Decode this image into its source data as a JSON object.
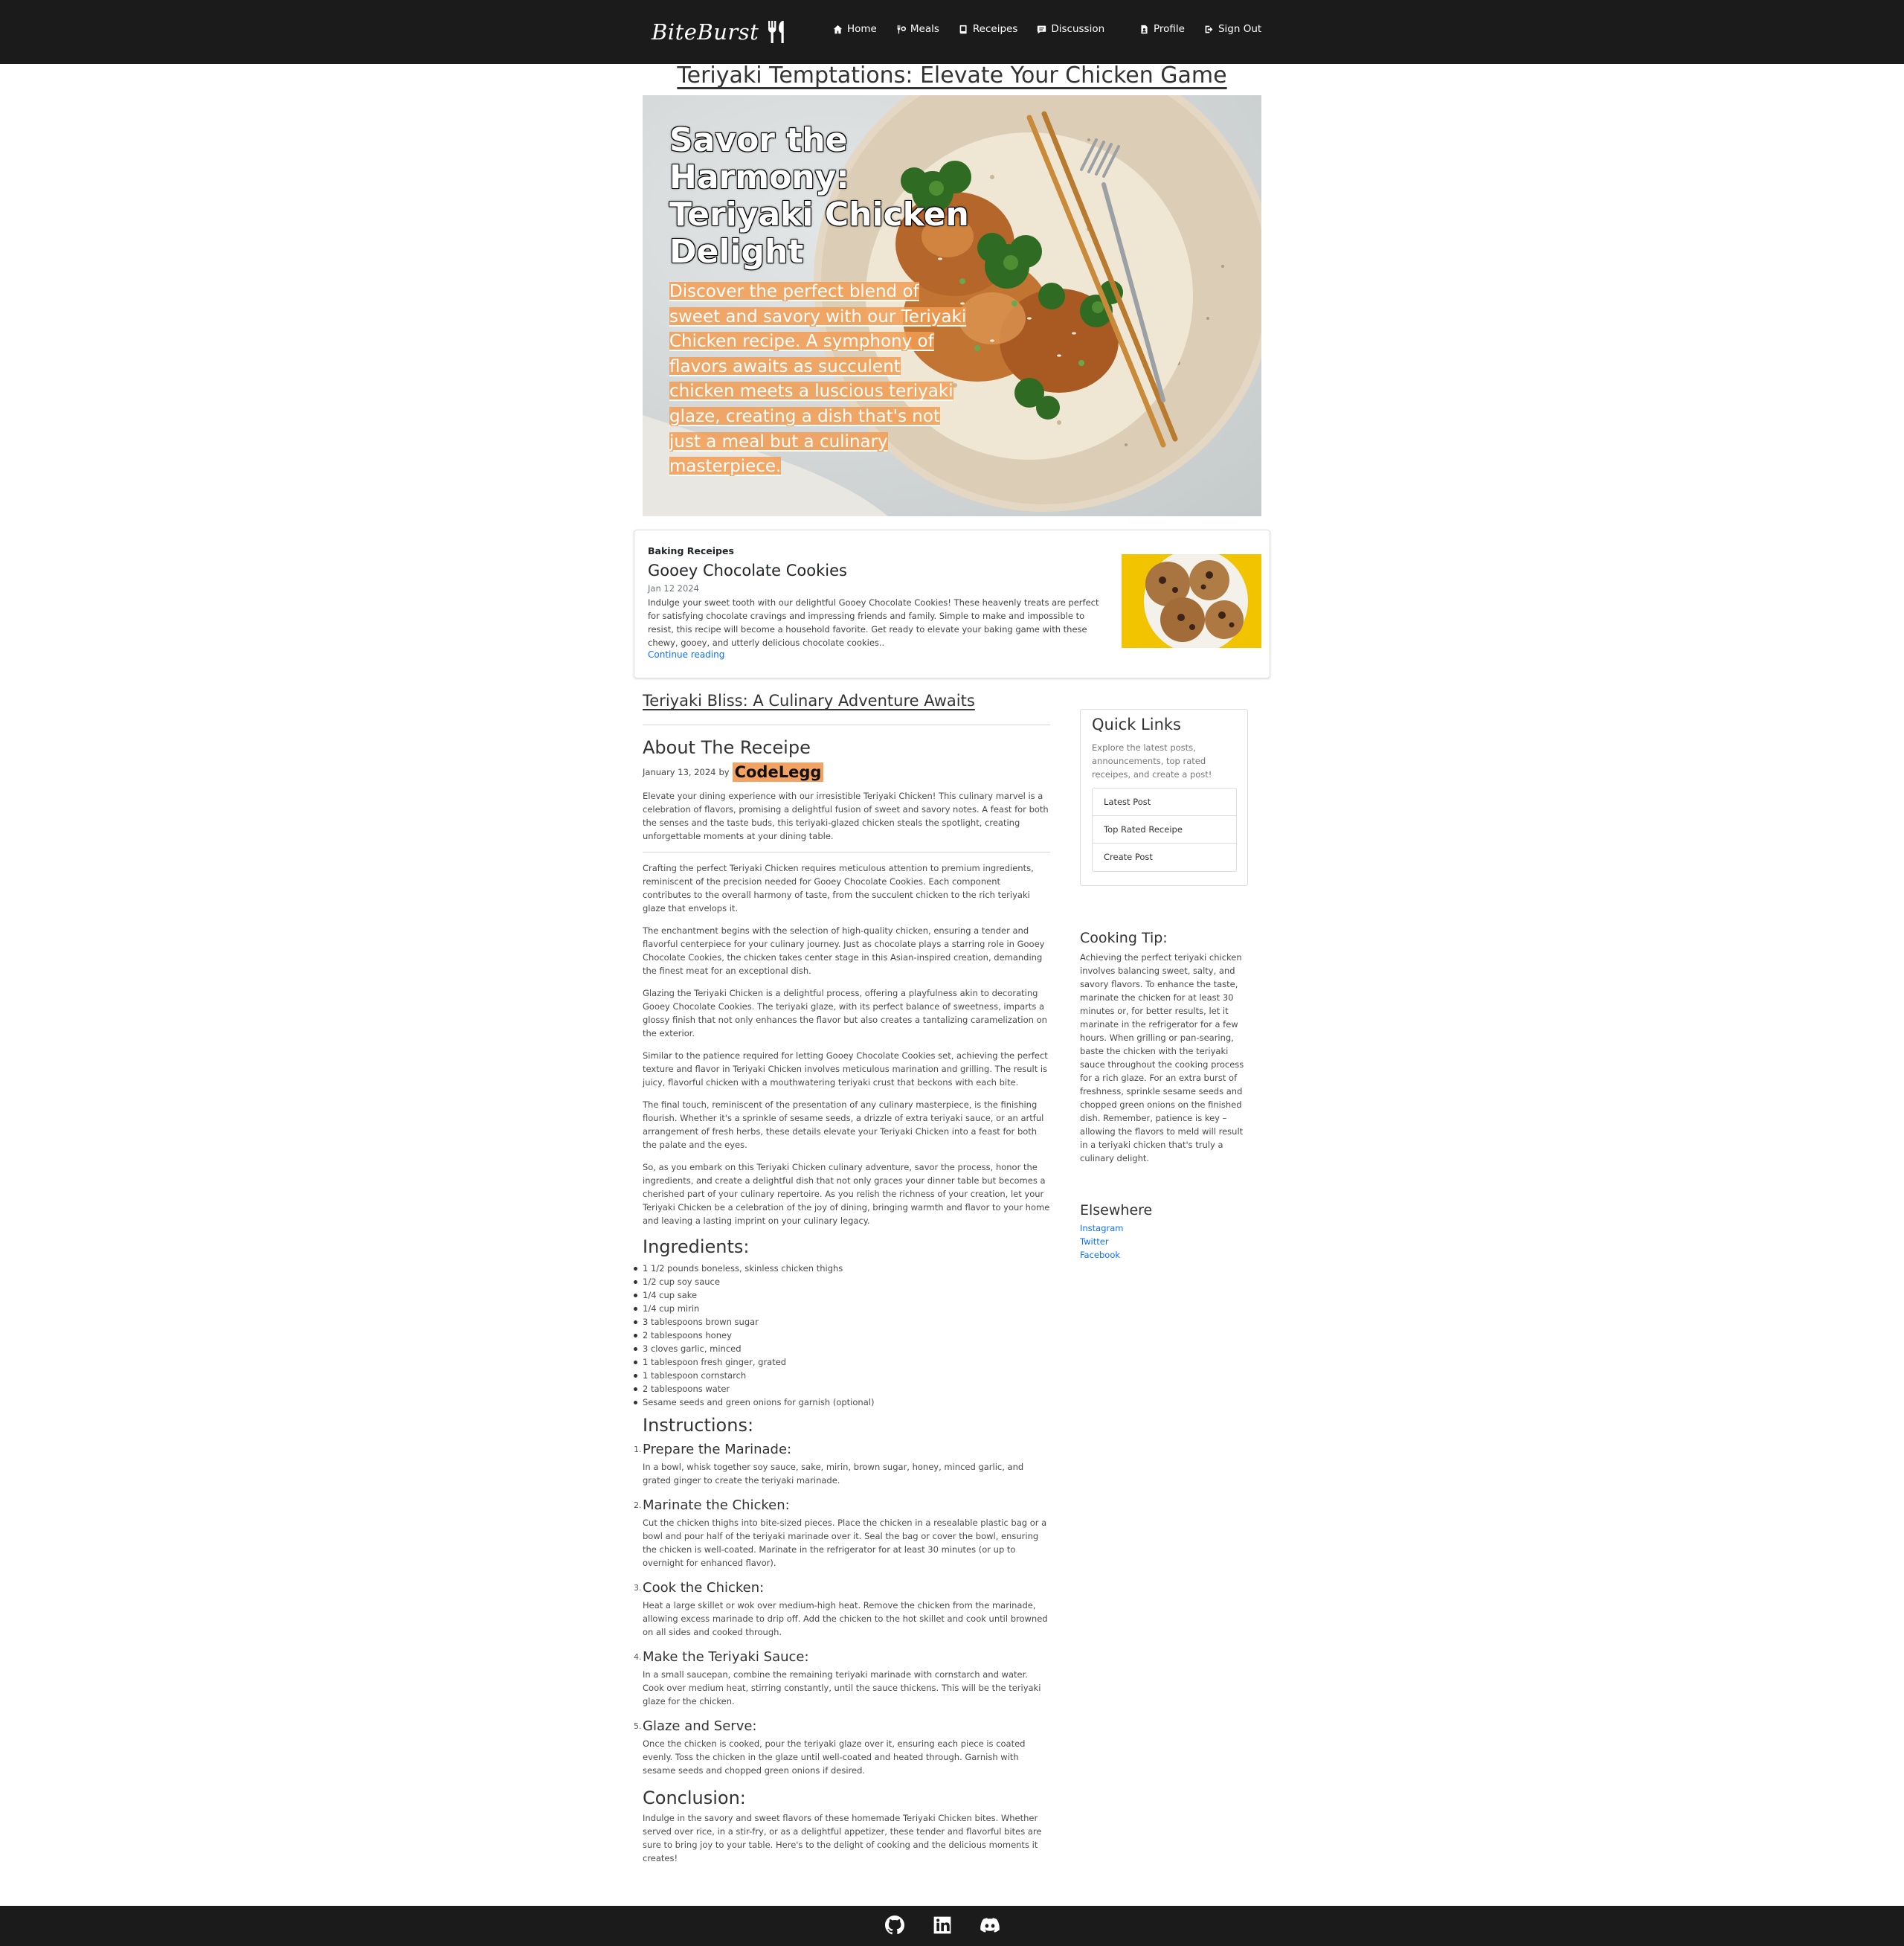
{
  "brand": {
    "name": "BiteBurst",
    "icon": "fork-knife-icon"
  },
  "nav": {
    "links": [
      {
        "label": "Home",
        "icon": "home-icon"
      },
      {
        "label": "Meals",
        "icon": "meals-icon"
      },
      {
        "label": "Receipes",
        "icon": "book-icon"
      },
      {
        "label": "Discussion",
        "icon": "chat-icon"
      }
    ],
    "right": [
      {
        "label": "Profile",
        "icon": "profile-icon"
      },
      {
        "label": "Sign Out",
        "icon": "sign-out-icon"
      }
    ]
  },
  "page_title": "Teriyaki Temptations: Elevate Your Chicken Game",
  "hero": {
    "heading": "Savor the Harmony: Teriyaki Chicken Delight",
    "description": "Discover the perfect blend of sweet and savory with our Teriyaki Chicken recipe. A symphony of flavors awaits as succulent chicken meets a luscious teriyaki glaze, creating a dish that's not just a meal but a culinary masterpiece."
  },
  "featured": {
    "category": "Baking Receipes",
    "title": "Gooey Chocolate Cookies",
    "date": "Jan 12 2024",
    "text": "Indulge your sweet tooth with our delightful Gooey Chocolate Cookies! These heavenly treats are perfect for satisfying chocolate cravings and impressing friends and family. Simple to make and impossible to resist, this recipe will become a household favorite. Get ready to elevate your baking game with these chewy, gooey, and utterly delicious chocolate cookies..",
    "link": "Continue reading"
  },
  "article": {
    "section_title": "Teriyaki Bliss: A Culinary Adventure Awaits",
    "heading": "About The Receipe",
    "date": "January 13, 2024",
    "by": "by",
    "author": "CodeLegg",
    "intro": "Elevate your dining experience with our irresistible Teriyaki Chicken! This culinary marvel is a celebration of flavors, promising a delightful fusion of sweet and savory notes. A feast for both the senses and the taste buds, this teriyaki-glazed chicken steals the spotlight, creating unforgettable moments at your dining table.",
    "paragraphs": [
      "Crafting the perfect Teriyaki Chicken requires meticulous attention to premium ingredients, reminiscent of the precision needed for Gooey Chocolate Cookies. Each component contributes to the overall harmony of taste, from the succulent chicken to the rich teriyaki glaze that envelops it.",
      "The enchantment begins with the selection of high-quality chicken, ensuring a tender and flavorful centerpiece for your culinary journey. Just as chocolate plays a starring role in Gooey Chocolate Cookies, the chicken takes center stage in this Asian-inspired creation, demanding the finest meat for an exceptional dish.",
      "Glazing the Teriyaki Chicken is a delightful process, offering a playfulness akin to decorating Gooey Chocolate Cookies. The teriyaki glaze, with its perfect balance of sweetness, imparts a glossy finish that not only enhances the flavor but also creates a tantalizing caramelization on the exterior.",
      "Similar to the patience required for letting Gooey Chocolate Cookies set, achieving the perfect texture and flavor in Teriyaki Chicken involves meticulous marination and grilling. The result is juicy, flavorful chicken with a mouthwatering teriyaki crust that beckons with each bite.",
      "The final touch, reminiscent of the presentation of any culinary masterpiece, is the finishing flourish. Whether it's a sprinkle of sesame seeds, a drizzle of extra teriyaki sauce, or an artful arrangement of fresh herbs, these details elevate your Teriyaki Chicken into a feast for both the palate and the eyes.",
      "So, as you embark on this Teriyaki Chicken culinary adventure, savor the process, honor the ingredients, and create a delightful dish that not only graces your dinner table but becomes a cherished part of your culinary repertoire. As you relish the richness of your creation, let your Teriyaki Chicken be a celebration of the joy of dining, bringing warmth and flavor to your home and leaving a lasting imprint on your culinary legacy."
    ],
    "ingredients_heading": "Ingredients:",
    "ingredients": [
      "1 1/2 pounds boneless, skinless chicken thighs",
      "1/2 cup soy sauce",
      "1/4 cup sake",
      "1/4 cup mirin",
      "3 tablespoons brown sugar",
      "2 tablespoons honey",
      "3 cloves garlic, minced",
      "1 tablespoon fresh ginger, grated",
      "1 tablespoon cornstarch",
      "2 tablespoons water",
      "Sesame seeds and green onions for garnish (optional)"
    ],
    "instructions_heading": "Instructions:",
    "instructions": [
      {
        "num": "1.",
        "title": "Prepare the Marinade:",
        "text": "In a bowl, whisk together soy sauce, sake, mirin, brown sugar, honey, minced garlic, and grated ginger to create the teriyaki marinade."
      },
      {
        "num": "2.",
        "title": "Marinate the Chicken:",
        "text": "Cut the chicken thighs into bite-sized pieces. Place the chicken in a resealable plastic bag or a bowl and pour half of the teriyaki marinade over it. Seal the bag or cover the bowl, ensuring the chicken is well-coated. Marinate in the refrigerator for at least 30 minutes (or up to overnight for enhanced flavor)."
      },
      {
        "num": "3.",
        "title": "Cook the Chicken:",
        "text": "Heat a large skillet or wok over medium-high heat. Remove the chicken from the marinade, allowing excess marinade to drip off. Add the chicken to the hot skillet and cook until browned on all sides and cooked through."
      },
      {
        "num": "4.",
        "title": "Make the Teriyaki Sauce:",
        "text": "In a small saucepan, combine the remaining teriyaki marinade with cornstarch and water. Cook over medium heat, stirring constantly, until the sauce thickens. This will be the teriyaki glaze for the chicken."
      },
      {
        "num": "5.",
        "title": "Glaze and Serve:",
        "text": "Once the chicken is cooked, pour the teriyaki glaze over it, ensuring each piece is coated evenly. Toss the chicken in the glaze until well-coated and heated through. Garnish with sesame seeds and chopped green onions if desired."
      }
    ],
    "conclusion_heading": "Conclusion:",
    "conclusion": "Indulge in the savory and sweet flavors of these homemade Teriyaki Chicken bites. Whether served over rice, in a stir-fry, or as a delightful appetizer, these tender and flavorful bites are sure to bring joy to your table. Here's to the delight of cooking and the delicious moments it creates!"
  },
  "sidebar": {
    "quick_links": {
      "title": "Quick Links",
      "description": "Explore the latest posts, announcements, top rated receipes, and create a post!",
      "links": [
        "Latest Post",
        "Top Rated Receipe",
        "Create Post"
      ]
    },
    "tip": {
      "title": "Cooking Tip:",
      "text": "Achieving the perfect teriyaki chicken involves balancing sweet, salty, and savory flavors. To enhance the taste, marinate the chicken for at least 30 minutes or, for better results, let it marinate in the refrigerator for a few hours. When grilling or pan-searing, baste the chicken with the teriyaki sauce throughout the cooking process for a rich glaze. For an extra burst of freshness, sprinkle sesame seeds and chopped green onions on the finished dish. Remember, patience is key – allowing the flavors to meld will result in a teriyaki chicken that's truly a culinary delight."
    },
    "elsewhere": {
      "title": "Elsewhere",
      "links": [
        "Instagram",
        "Twitter",
        "Facebook"
      ]
    }
  },
  "footer": {
    "icons": [
      "github-icon",
      "linkedin-icon",
      "discord-icon"
    ]
  },
  "colors": {
    "navbar": "#1b1b1b",
    "accent": "#f4a261",
    "link": "#0d6efd"
  }
}
